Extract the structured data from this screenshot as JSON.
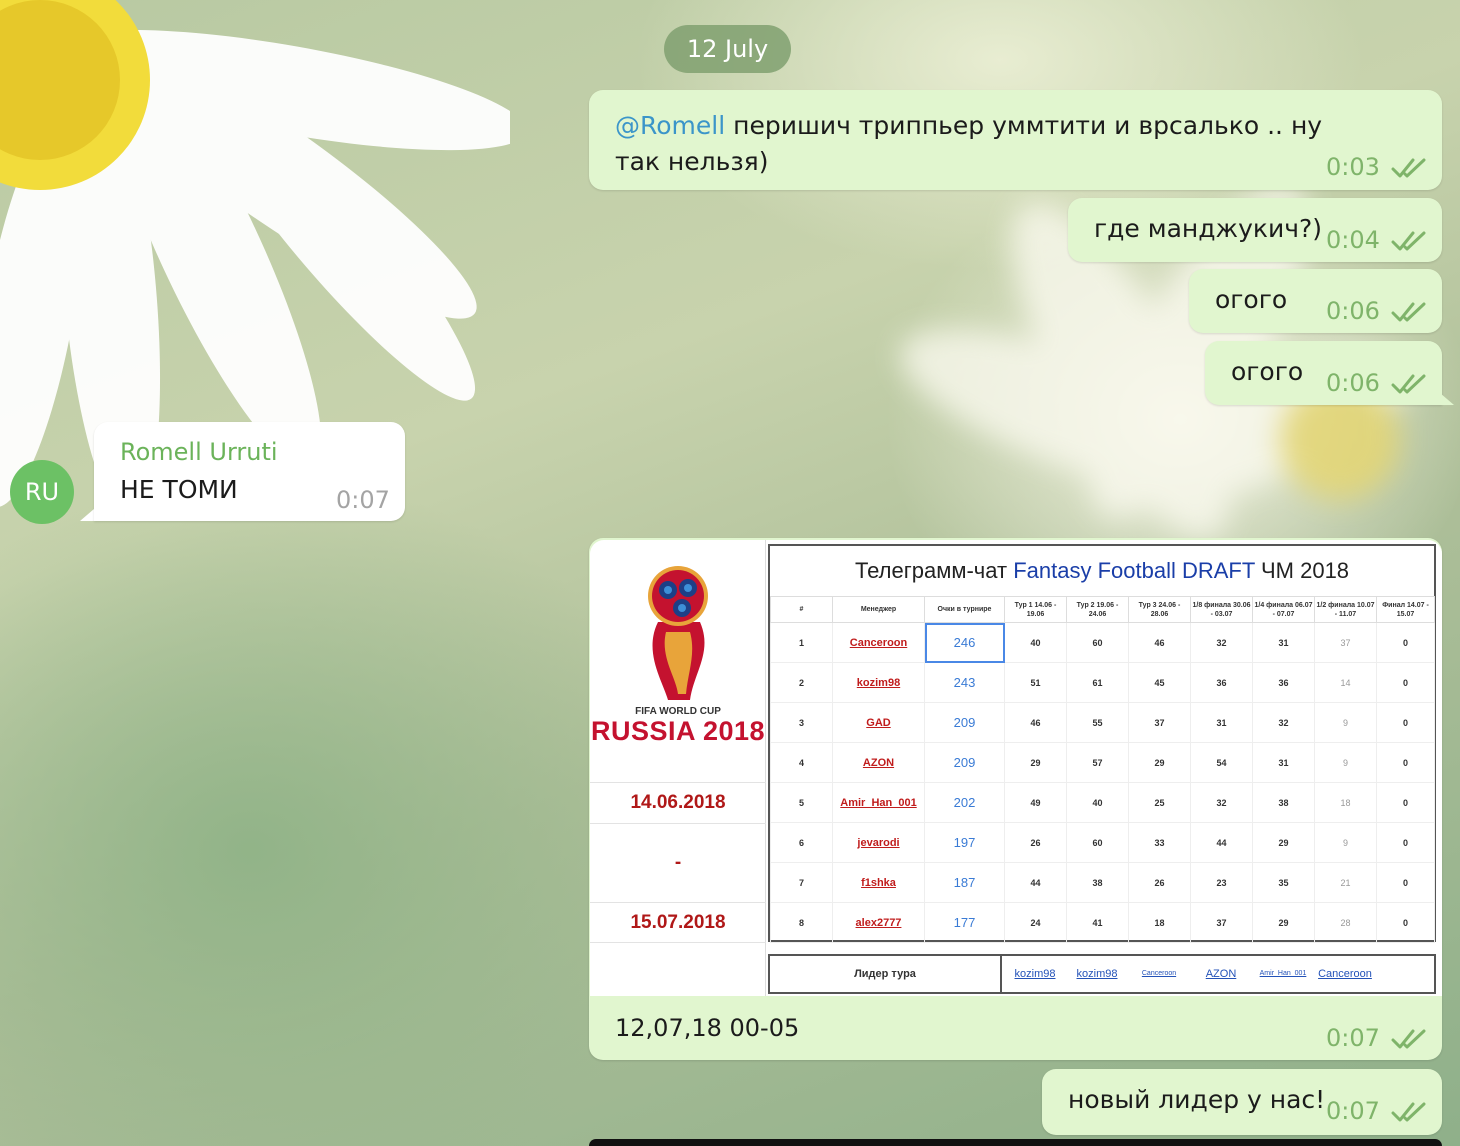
{
  "date_separator": "12 July",
  "messages_top": [
    {
      "mention": "@Romell",
      "text": " перишич триппьер уммтити и врсалько .. ну так нельзя)",
      "time": "0:03"
    },
    {
      "text": "где манджукич?)",
      "time": "0:04"
    },
    {
      "text": "огого",
      "time": "0:06"
    },
    {
      "text": "огого",
      "time": "0:06"
    }
  ],
  "incoming": {
    "avatar_initials": "RU",
    "sender": "Romell Urruti",
    "text": "НЕ ТОМИ",
    "time": "0:07"
  },
  "media_message": {
    "caption": "12,07,18 00-05",
    "time": "0:07",
    "image": {
      "logo_line1": "FIFA WORLD CUP",
      "logo_line2": "RUSSIA 2018",
      "start_date": "14.06.2018",
      "dash": "-",
      "end_date": "15.07.2018",
      "title_prefix": "Телеграмм-чат ",
      "title_blue": "Fantasy Football DRAFT",
      "title_suffix": " ЧМ 2018",
      "columns": [
        "#",
        "Менеджер",
        "Очки в турнире",
        "Тур 1 14.06 - 19.06",
        "Тур 2 19.06 - 24.06",
        "Тур 3 24.06 - 28.06",
        "1/8 финала 30.06 - 03.07",
        "1/4 финала 06.07 - 07.07",
        "1/2 финала 10.07 - 11.07",
        "Финал 14.07 - 15.07"
      ],
      "rows": [
        [
          "1",
          "Canceroon",
          "246",
          "40",
          "60",
          "46",
          "32",
          "31",
          "37",
          "0"
        ],
        [
          "2",
          "kozim98",
          "243",
          "51",
          "61",
          "45",
          "36",
          "36",
          "14",
          "0"
        ],
        [
          "3",
          "GAD",
          "209",
          "46",
          "55",
          "37",
          "31",
          "32",
          "9",
          "0"
        ],
        [
          "4",
          "AZON",
          "209",
          "29",
          "57",
          "29",
          "54",
          "31",
          "9",
          "0"
        ],
        [
          "5",
          "Amir_Han_001",
          "202",
          "49",
          "40",
          "25",
          "32",
          "38",
          "18",
          "0"
        ],
        [
          "6",
          "jevarodi",
          "197",
          "26",
          "60",
          "33",
          "44",
          "29",
          "9",
          "0"
        ],
        [
          "7",
          "f1shka",
          "187",
          "44",
          "38",
          "26",
          "23",
          "35",
          "21",
          "0"
        ],
        [
          "8",
          "alex2777",
          "177",
          "24",
          "41",
          "18",
          "37",
          "29",
          "28",
          "0"
        ]
      ],
      "leader_label": "Лидер тура",
      "leaders": [
        "kozim98",
        "kozim98",
        "Canceroon",
        "AZON",
        "Amir_Han_001",
        "Canceroon"
      ]
    }
  },
  "last_message": {
    "text": "новый лидер у нас!",
    "time": "0:07"
  },
  "colors": {
    "outgoing_bubble": "#e1f6cf",
    "time_green": "#7fb46a",
    "mention_blue": "#3b95c9",
    "avatar_green": "#6cc165"
  }
}
